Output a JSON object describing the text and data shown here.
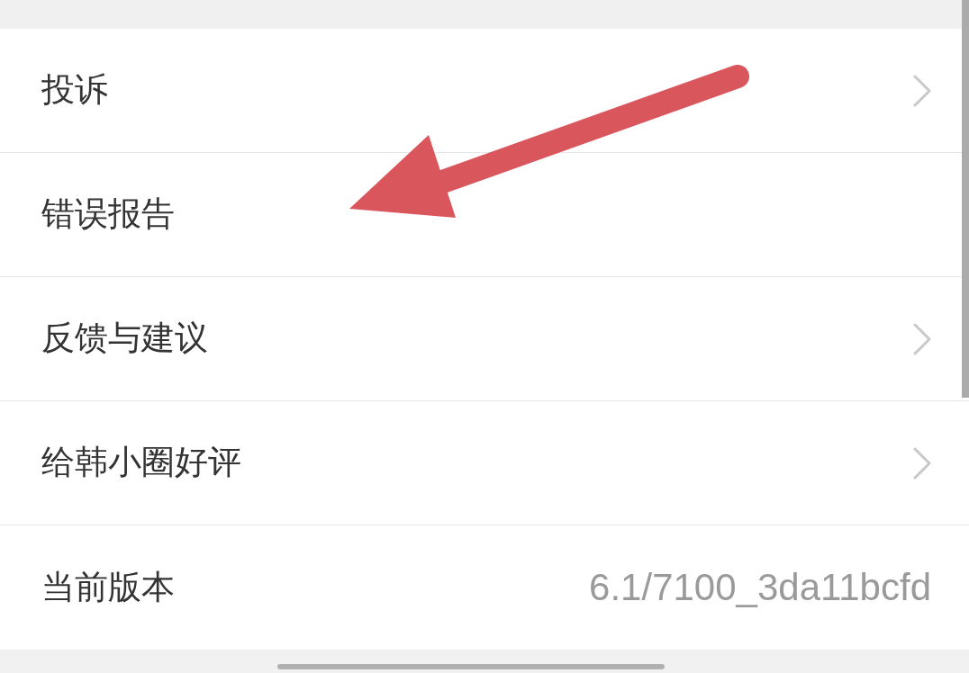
{
  "menu": {
    "items": [
      {
        "label": "投诉",
        "kind": "link"
      },
      {
        "label": "错误报告",
        "kind": "plain"
      },
      {
        "label": "反馈与建议",
        "kind": "link"
      },
      {
        "label": "给韩小圈好评",
        "kind": "link"
      },
      {
        "label": "当前版本",
        "kind": "info",
        "value": "6.1/7100_3da11bcfd"
      }
    ]
  },
  "callout": {
    "kind": "arrow"
  }
}
